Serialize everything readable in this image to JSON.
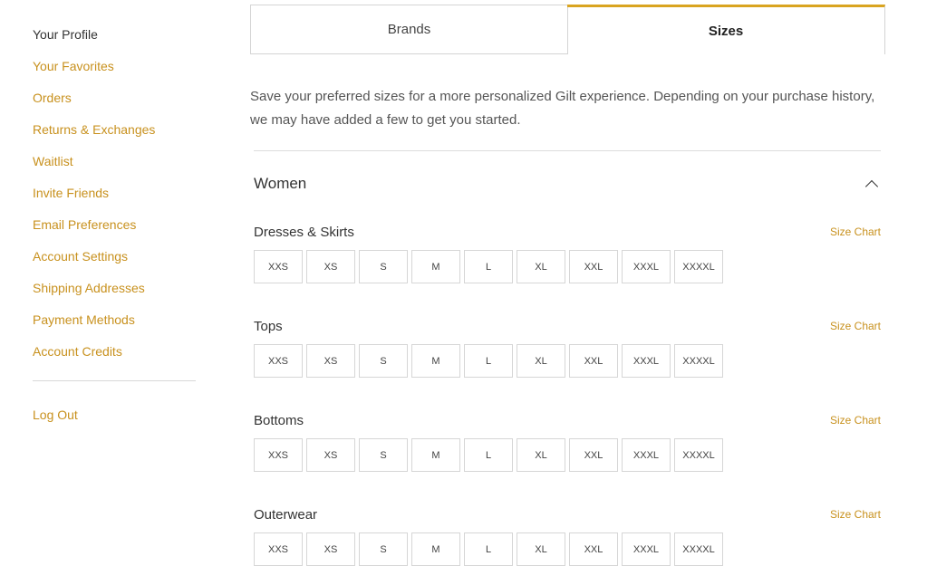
{
  "sidebar": {
    "items": [
      {
        "label": "Your Profile",
        "active": true
      },
      {
        "label": "Your Favorites"
      },
      {
        "label": "Orders"
      },
      {
        "label": "Returns & Exchanges"
      },
      {
        "label": "Waitlist"
      },
      {
        "label": "Invite Friends"
      },
      {
        "label": "Email Preferences"
      },
      {
        "label": "Account Settings"
      },
      {
        "label": "Shipping Addresses"
      },
      {
        "label": "Payment Methods"
      },
      {
        "label": "Account Credits"
      }
    ],
    "logout_label": "Log Out"
  },
  "tabs": [
    {
      "label": "Brands"
    },
    {
      "label": "Sizes",
      "active": true
    }
  ],
  "intro_text": "Save your preferred sizes for a more personalized Gilt experience. Depending on your purchase history, we may have added a few to get you started.",
  "section": {
    "title": "Women",
    "expanded": true
  },
  "size_chart_label": "Size Chart",
  "sizes": [
    "XXS",
    "XS",
    "S",
    "M",
    "L",
    "XL",
    "XXL",
    "XXXL",
    "XXXXL"
  ],
  "categories": [
    {
      "title": "Dresses & Skirts"
    },
    {
      "title": "Tops"
    },
    {
      "title": "Bottoms"
    },
    {
      "title": "Outerwear"
    }
  ],
  "colors": {
    "accent": "#c8911e",
    "tab_active_border": "#d9a420"
  },
  "icons": {
    "collapse": "chevron-up-icon"
  }
}
